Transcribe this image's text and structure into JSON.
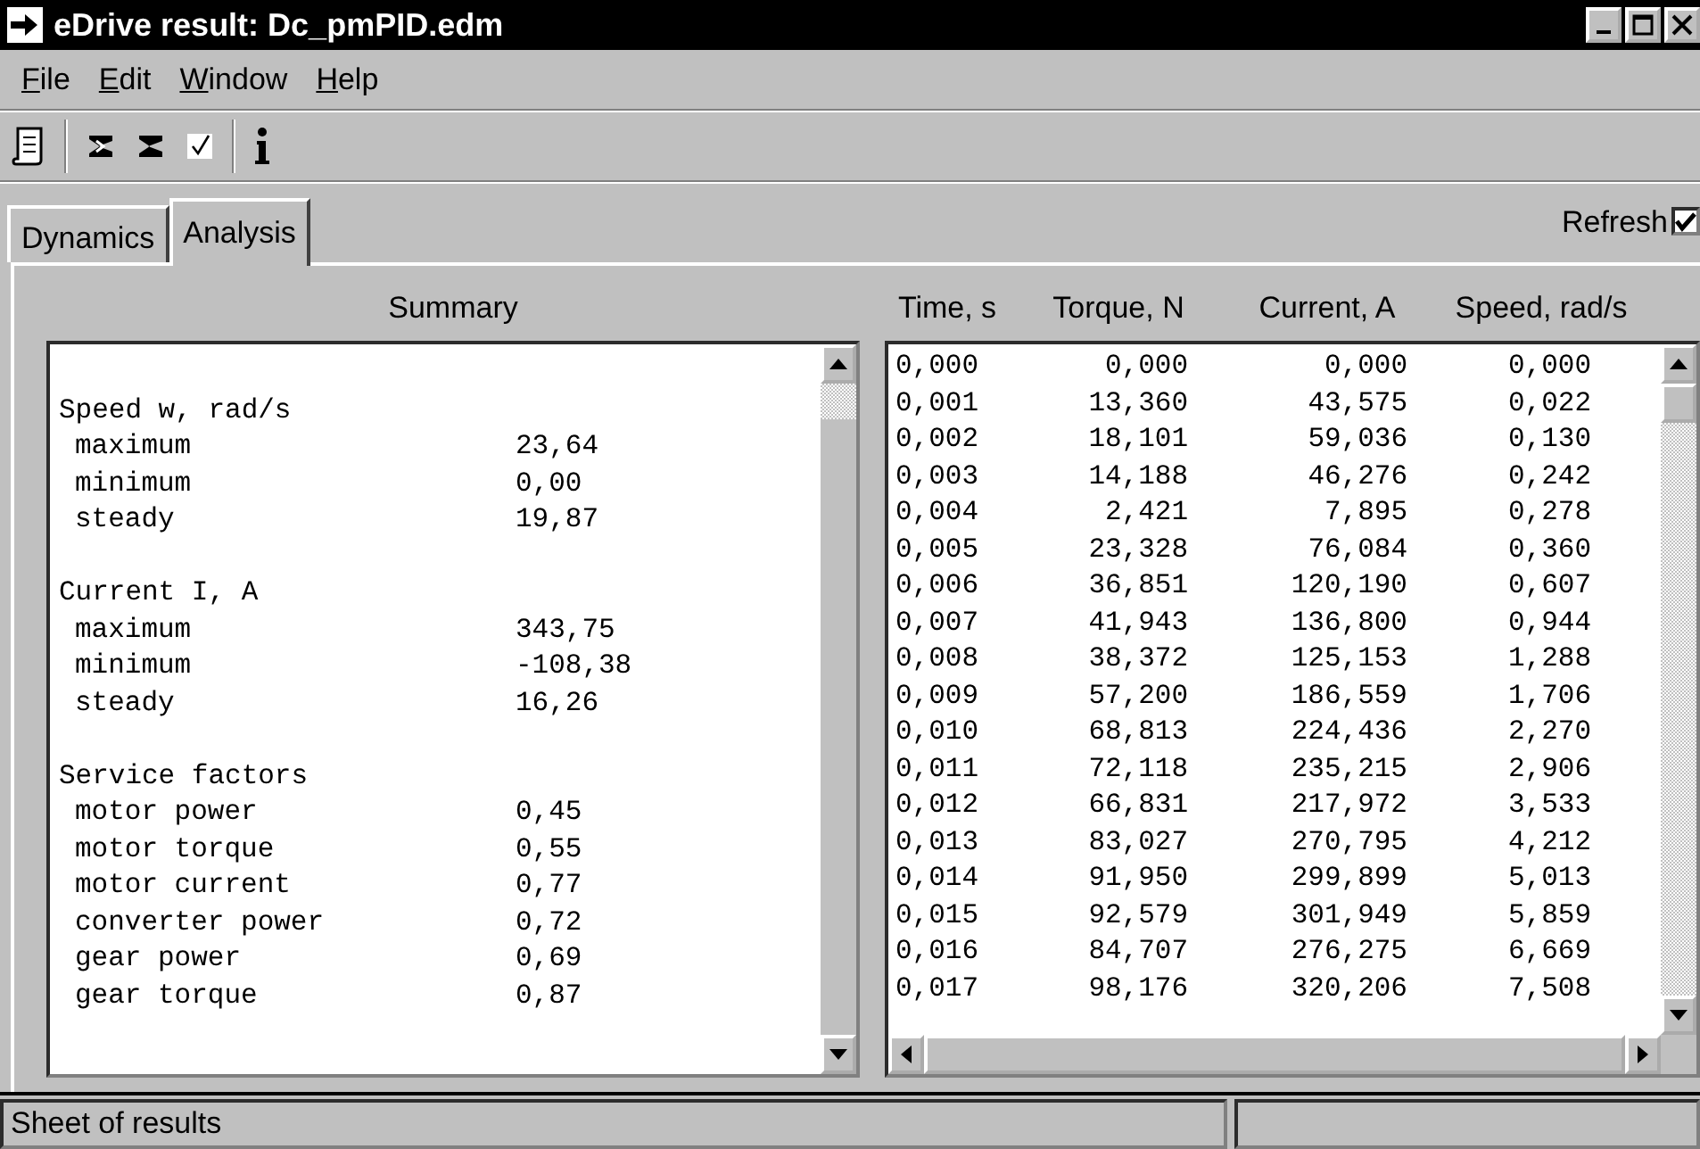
{
  "window": {
    "title": "eDrive result: Dc_pmPID.edm"
  },
  "menu": [
    {
      "label": "File",
      "mnemonic": true
    },
    {
      "label": "Edit",
      "mnemonic": true
    },
    {
      "label": "Window",
      "mnemonic": true
    },
    {
      "label": "Help",
      "mnemonic": true
    }
  ],
  "tabs": [
    {
      "label": "Dynamics",
      "selected": false
    },
    {
      "label": "Analysis",
      "selected": true
    }
  ],
  "refresh": {
    "label": "Refresh",
    "checked": true
  },
  "summary": {
    "title": "Summary",
    "sections": [
      {
        "heading": "Speed w, rad/s",
        "items": [
          {
            "label": "maximum",
            "value": "23,64"
          },
          {
            "label": "minimum",
            "value": "0,00"
          },
          {
            "label": "steady",
            "value": "19,87"
          }
        ]
      },
      {
        "heading": "Current I, A",
        "items": [
          {
            "label": "maximum",
            "value": "343,75"
          },
          {
            "label": "minimum",
            "value": "-108,38"
          },
          {
            "label": "steady",
            "value": "16,26"
          }
        ]
      },
      {
        "heading": "Service factors",
        "items": [
          {
            "label": "motor power",
            "value": "0,45"
          },
          {
            "label": "motor torque",
            "value": "0,55"
          },
          {
            "label": "motor current",
            "value": "0,77"
          },
          {
            "label": "converter power",
            "value": "0,72"
          },
          {
            "label": "gear power",
            "value": "0,69"
          },
          {
            "label": "gear torque",
            "value": "0,87"
          }
        ]
      }
    ]
  },
  "results": {
    "columns": [
      "Time, s",
      "Torque, N",
      "Current, A",
      "Speed, rad/s"
    ],
    "rows": [
      [
        "0,000",
        "0,000",
        "0,000",
        "0,000"
      ],
      [
        "0,001",
        "13,360",
        "43,575",
        "0,022"
      ],
      [
        "0,002",
        "18,101",
        "59,036",
        "0,130"
      ],
      [
        "0,003",
        "14,188",
        "46,276",
        "0,242"
      ],
      [
        "0,004",
        "2,421",
        "7,895",
        "0,278"
      ],
      [
        "0,005",
        "23,328",
        "76,084",
        "0,360"
      ],
      [
        "0,006",
        "36,851",
        "120,190",
        "0,607"
      ],
      [
        "0,007",
        "41,943",
        "136,800",
        "0,944"
      ],
      [
        "0,008",
        "38,372",
        "125,153",
        "1,288"
      ],
      [
        "0,009",
        "57,200",
        "186,559",
        "1,706"
      ],
      [
        "0,010",
        "68,813",
        "224,436",
        "2,270"
      ],
      [
        "0,011",
        "72,118",
        "235,215",
        "2,906"
      ],
      [
        "0,012",
        "66,831",
        "217,972",
        "3,533"
      ],
      [
        "0,013",
        "83,027",
        "270,795",
        "4,212"
      ],
      [
        "0,014",
        "91,950",
        "299,899",
        "5,013"
      ],
      [
        "0,015",
        "92,579",
        "301,949",
        "5,859"
      ],
      [
        "0,016",
        "84,707",
        "276,275",
        "6,669"
      ],
      [
        "0,017",
        "98,176",
        "320,206",
        "7,508"
      ]
    ]
  },
  "status_bar": {
    "panes": [
      "Sheet of results"
    ]
  }
}
